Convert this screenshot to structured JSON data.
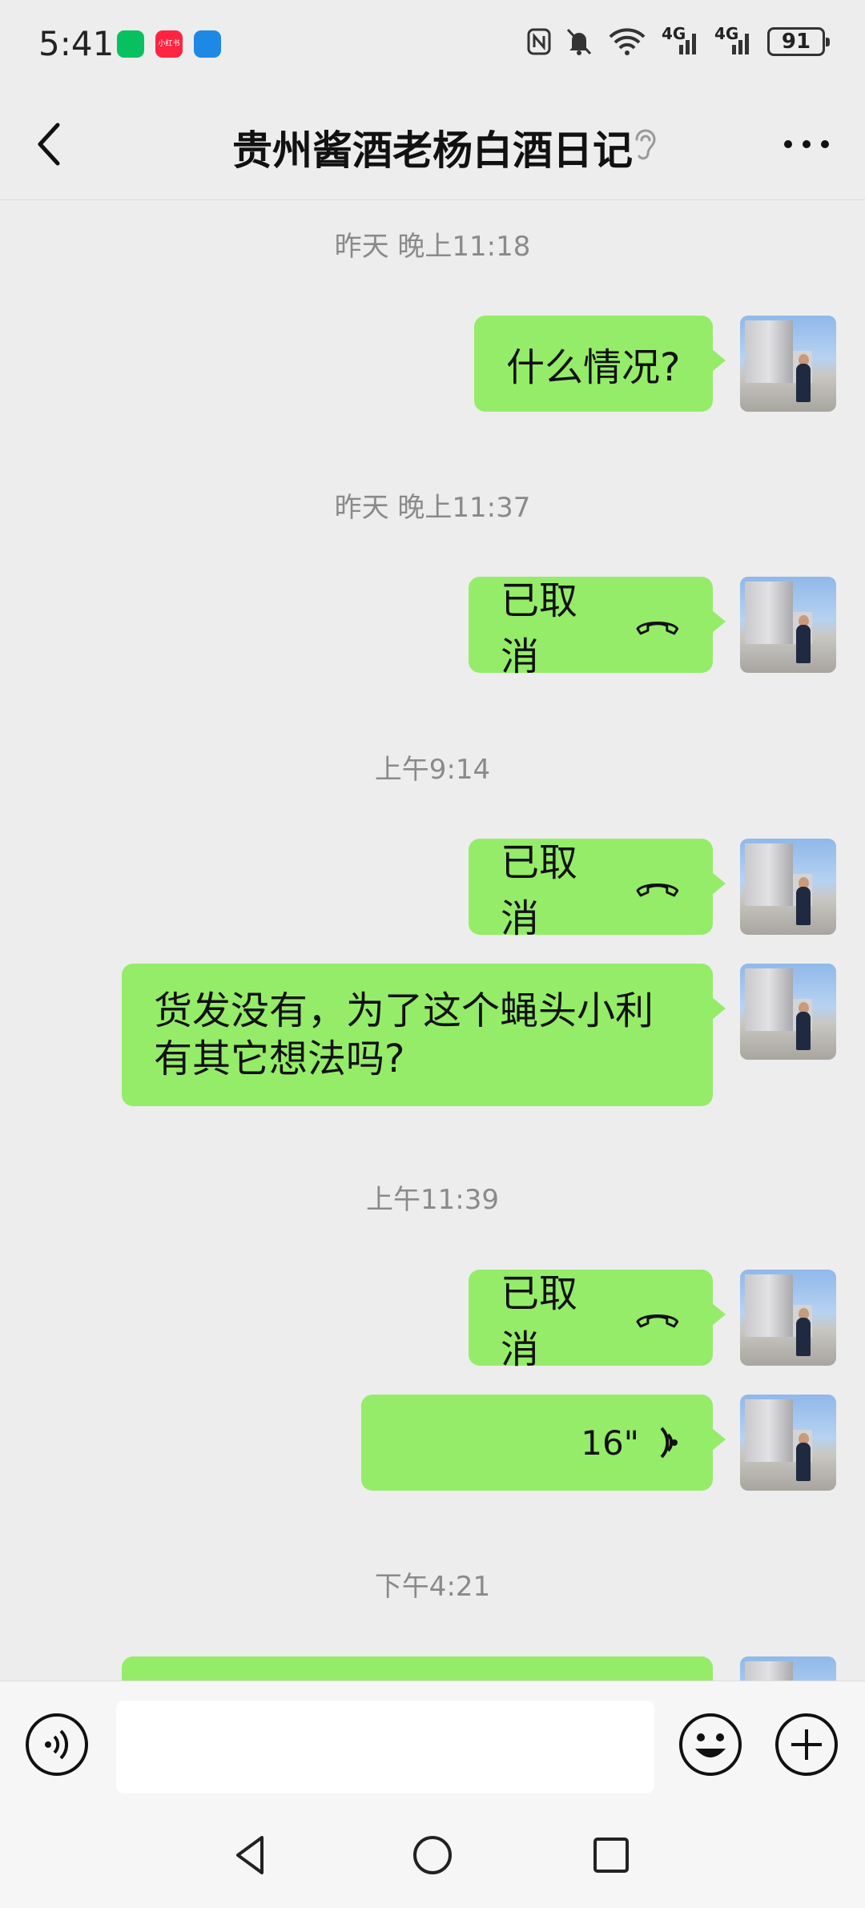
{
  "status_bar": {
    "time": "5:41",
    "app_icon_small_label": "小红书",
    "network_label": "4G",
    "network_label_2": "4G",
    "battery": "91"
  },
  "header": {
    "title": "贵州酱酒老杨白酒日记"
  },
  "messages": [
    {
      "type": "timestamp",
      "text": "昨天 晚上11:18"
    },
    {
      "type": "text",
      "text": "什么情况?"
    },
    {
      "type": "timestamp",
      "text": "昨天 晚上11:37"
    },
    {
      "type": "call",
      "text": "已取消"
    },
    {
      "type": "timestamp",
      "text": "上午9:14"
    },
    {
      "type": "call",
      "text": "已取消"
    },
    {
      "type": "text",
      "text": "货发没有，为了这个蝇头小利 有其它想法吗?",
      "line1": "货发没有，为了这个蝇头小利",
      "line2": "有其它想法吗?"
    },
    {
      "type": "timestamp",
      "text": "上午11:39"
    },
    {
      "type": "call",
      "text": "已取消"
    },
    {
      "type": "voice",
      "text": "16\""
    },
    {
      "type": "timestamp",
      "text": "下午4:21"
    }
  ],
  "input": {
    "value": ""
  },
  "colors": {
    "bubble": "#95ec69",
    "background": "#ededed",
    "timestamp": "#8a8a8a"
  }
}
